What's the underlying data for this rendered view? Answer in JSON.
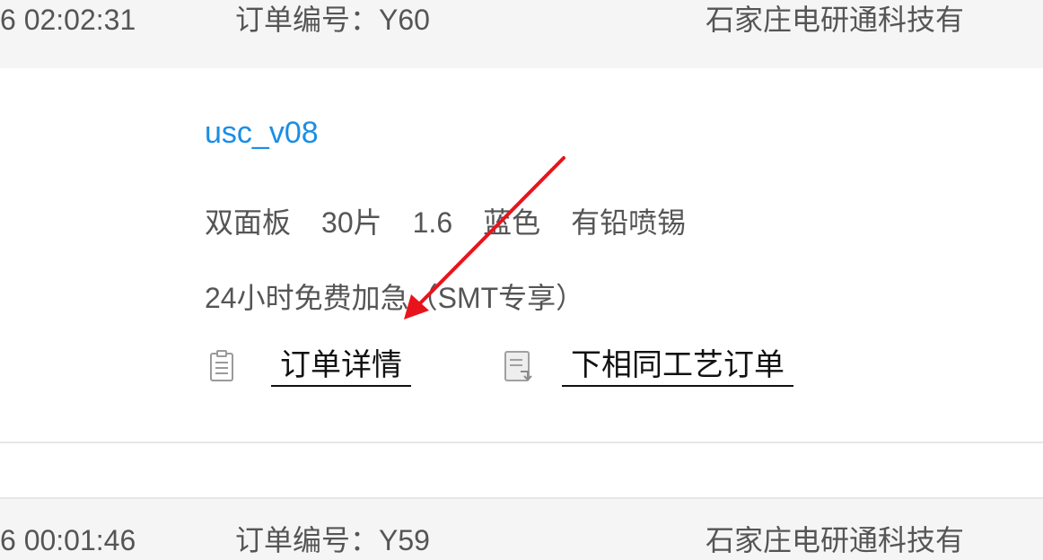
{
  "orders": [
    {
      "time": "6 02:02:31",
      "order_number": "订单编号：Y60",
      "company": "石家庄电研通科技有"
    },
    {
      "time": "6 00:01:46",
      "order_number": "订单编号：Y59",
      "company": "石家庄电研通科技有"
    }
  ],
  "item": {
    "name": "usc_v08",
    "specs": [
      "双面板",
      "30片",
      "1.6",
      "蓝色",
      "有铅喷锡"
    ],
    "rush": "24小时免费加急（SMT专享）",
    "actions": {
      "detail_label": "订单详情",
      "reorder_label": "下相同工艺订单"
    }
  },
  "colors": {
    "link_blue": "#1a8ee6",
    "annotation_arrow": "#e8141c",
    "header_bg": "#f5f5f5"
  },
  "icons": {
    "detail": "clipboard-list-icon",
    "reorder": "document-reorder-icon"
  }
}
